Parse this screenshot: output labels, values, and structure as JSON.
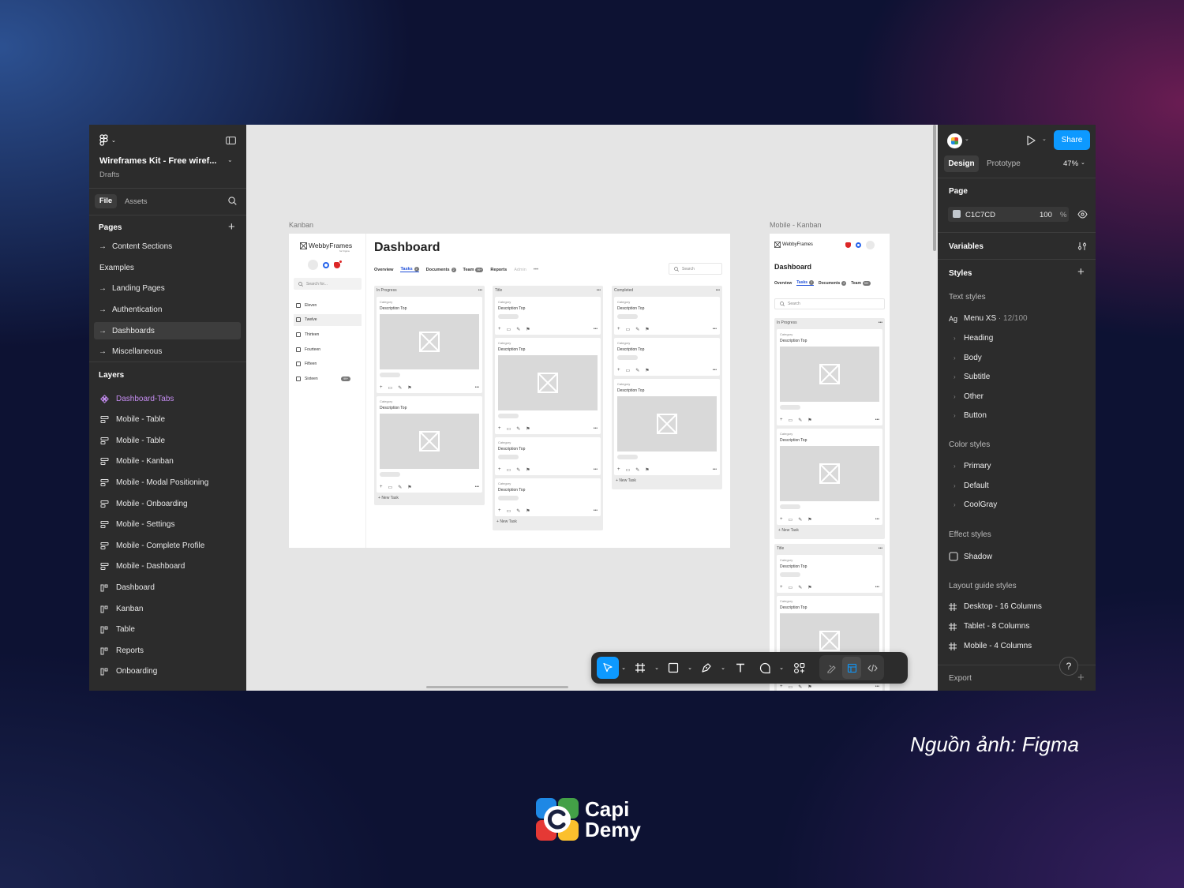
{
  "file": {
    "title": "Wireframes Kit - Free wiref...",
    "location": "Drafts",
    "tabs": [
      "File",
      "Assets"
    ]
  },
  "pages": {
    "header": "Pages",
    "items": [
      "Content Sections",
      "Examples",
      "Landing Pages",
      "Authentication",
      "Dashboards",
      "Miscellaneous"
    ],
    "selected": "Dashboards"
  },
  "layers": {
    "header": "Layers",
    "items": [
      "Dashboard-Tabs",
      "Mobile - Table",
      "Mobile - Table",
      "Mobile - Kanban",
      "Mobile - Modal Positioning",
      "Mobile - Onboarding",
      "Mobile - Settings",
      "Mobile - Complete Profile",
      "Mobile - Dashboard",
      "Dashboard",
      "Kanban",
      "Table",
      "Reports",
      "Onboarding"
    ]
  },
  "canvas": {
    "kanban_label": "Kanban",
    "mobile_label": "Mobile - Kanban",
    "brand": "WebbyFrames",
    "brand_sub": "for Figma",
    "search_for": "Search for...",
    "nav": [
      "Eleven",
      "Twelve",
      "Thirteen",
      "Fourteen",
      "Fifteen",
      "Sixteen"
    ],
    "nav_badge": "99+",
    "dash_title": "Dashboard",
    "tabs": [
      "Overview",
      "Tasks",
      "Documents",
      "Team",
      "Reports",
      "Admin"
    ],
    "tab_badges": {
      "Tasks": "2",
      "Documents": "2",
      "Team": "99+"
    },
    "search": "Search",
    "columns": [
      "In Progress",
      "Title",
      "Completed"
    ],
    "category": "Category",
    "desc": "Description Top",
    "new_task": "New Task"
  },
  "toolbar": {
    "tools": [
      "move-tool",
      "frame-tool",
      "shape-tool",
      "pen-tool",
      "text-tool",
      "comment-tool",
      "actions-tool",
      "draw-mode",
      "dev-mode-toggle",
      "code-view"
    ]
  },
  "right": {
    "share": "Share",
    "tabs": [
      "Design",
      "Prototype"
    ],
    "zoom": "47%",
    "page_header": "Page",
    "page_color": "C1C7CD",
    "page_opacity": "100",
    "percent": "%",
    "variables": "Variables",
    "styles": "Styles",
    "text_styles_header": "Text styles",
    "text_style_ag": "Ag",
    "text_style_first": "Menu XS",
    "text_style_first_meta": "12/100",
    "text_styles": [
      "Heading",
      "Body",
      "Subtitle",
      "Other",
      "Button"
    ],
    "color_styles_header": "Color styles",
    "color_styles": [
      "Primary",
      "Default",
      "CoolGray"
    ],
    "effect_styles_header": "Effect styles",
    "effect_styles": [
      "Shadow"
    ],
    "layout_styles_header": "Layout guide styles",
    "layout_styles": [
      "Desktop - 16 Columns",
      "Tablet - 8 Columns",
      "Mobile - 4 Columns"
    ],
    "export": "Export",
    "help": "?"
  },
  "colors": {
    "accent": "#0d99ff",
    "selected_layer": "#c48cf0"
  },
  "caption": "Nguồn ảnh: Figma",
  "logo": {
    "line1": "Capi",
    "line2": "Demy"
  }
}
